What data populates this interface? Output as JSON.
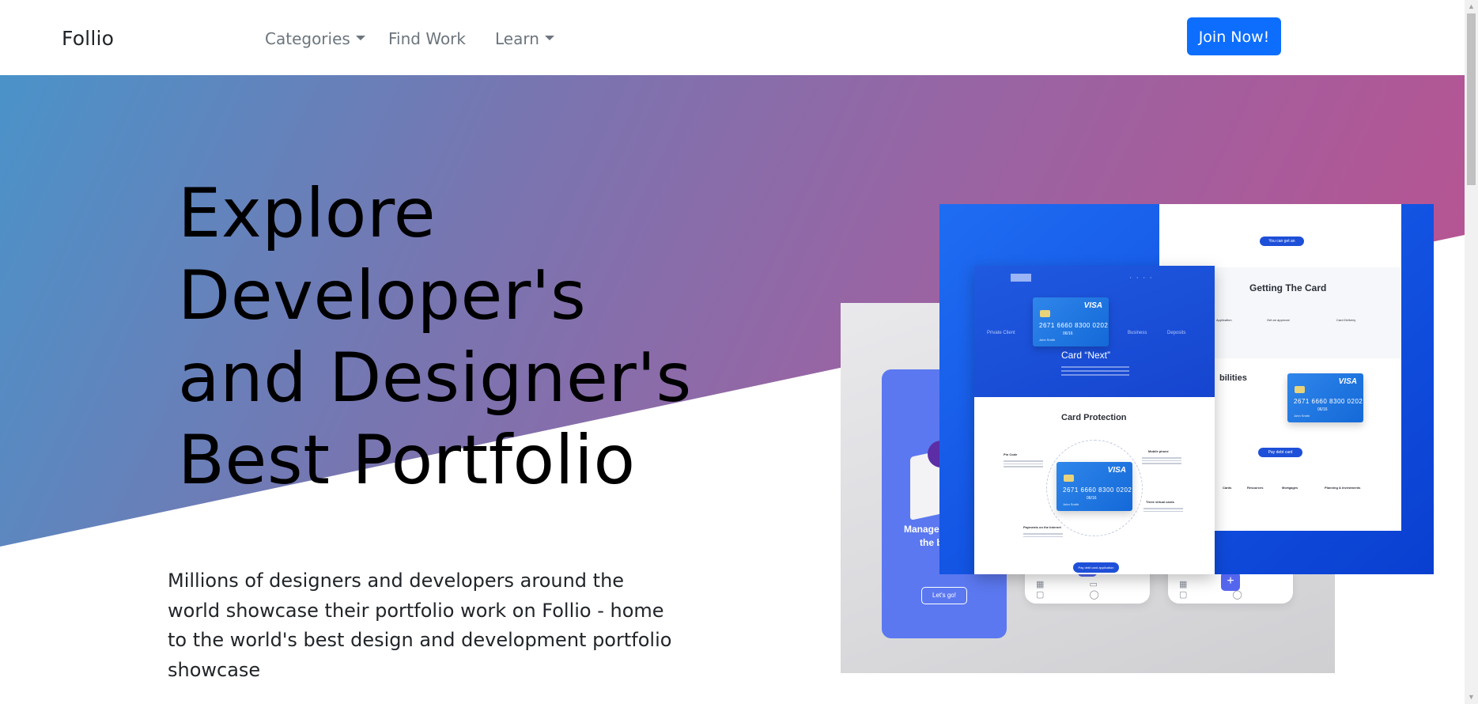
{
  "navbar": {
    "brand": "Follio",
    "links": [
      {
        "label": "Categories",
        "has_dropdown": true
      },
      {
        "label": "Find Work",
        "has_dropdown": false
      },
      {
        "label": "Learn",
        "has_dropdown": true
      }
    ],
    "cta_label": "Join Now!"
  },
  "hero": {
    "title_lines": [
      "Explore",
      "Developer's",
      "and Designer's",
      "Best Portfolio"
    ],
    "description": "Millions of designers and developers around the world showcase their portfolio work on Follio - home to the world's best design and development portfolio showcase",
    "gradient_colors": [
      "#4a93c9",
      "#9765a4",
      "#c14e8d"
    ]
  },
  "showcase": {
    "app_headline_1": "Manage",
    "app_headline_2": "the b",
    "app_button": "Let's go!",
    "card_next_title": "Card “Next”",
    "card_protection_title": "Card Protection",
    "getting_card_title": "Getting The Card",
    "abilities_title": "bilities",
    "tabs": [
      "Private Client",
      "Business",
      "Deposits"
    ],
    "card": {
      "brand": "VISA",
      "number": "2671  6660  8300  0202",
      "expiry": "06/16",
      "holder": "John Smith"
    },
    "get_application": "You can get an application",
    "apply_label": "Pay debt card application",
    "steps": [
      "Application",
      "Get an approval",
      "Card Delivery"
    ],
    "protection_items": [
      "Pin Code",
      "Mobile phone",
      "Three virtual cards",
      "Payments on the Internet"
    ],
    "footer_cols": [
      "Cards",
      "Resources",
      "Mortgages",
      "Planning & Investments"
    ]
  },
  "colors": {
    "primary": "#0d6efd",
    "mock_blue": "#1456e5",
    "app_purple": "#5b78f0"
  }
}
